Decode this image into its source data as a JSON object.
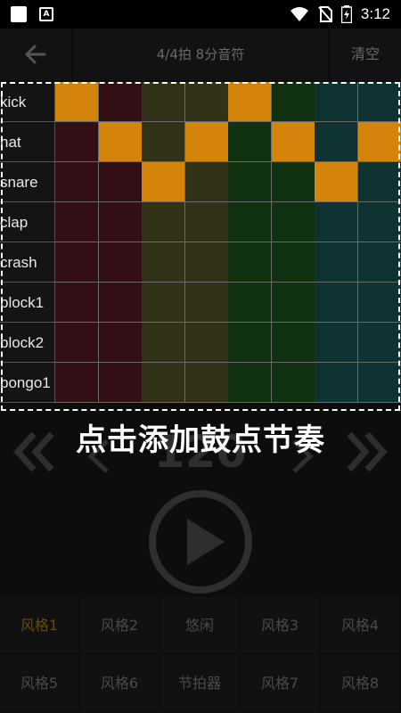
{
  "status_bar": {
    "time": "3:12",
    "notification_icons": [
      "square-icon",
      "a-box-icon"
    ],
    "system_icons": [
      "wifi-icon",
      "no-sim-icon",
      "battery-charging-icon"
    ]
  },
  "topbar": {
    "back_icon": "arrow-left-icon",
    "title": "4/4拍 8分音符",
    "clear_label": "清空"
  },
  "grid": {
    "column_colors": [
      "#320f15",
      "#320f15",
      "#323218",
      "#323218",
      "#113211",
      "#113211",
      "#0f3232",
      "#0f3232"
    ],
    "active_color": "#d4840a",
    "rows": [
      {
        "label": "kick",
        "steps": [
          1,
          0,
          0,
          0,
          1,
          0,
          0,
          0
        ]
      },
      {
        "label": "hat",
        "steps": [
          0,
          1,
          0,
          1,
          0,
          1,
          0,
          1
        ]
      },
      {
        "label": "snare",
        "steps": [
          0,
          0,
          1,
          0,
          0,
          0,
          1,
          0
        ]
      },
      {
        "label": "clap",
        "steps": [
          0,
          0,
          0,
          0,
          0,
          0,
          0,
          0
        ]
      },
      {
        "label": "crash",
        "steps": [
          0,
          0,
          0,
          0,
          0,
          0,
          0,
          0
        ]
      },
      {
        "label": "block1",
        "steps": [
          0,
          0,
          0,
          0,
          0,
          0,
          0,
          0
        ]
      },
      {
        "label": "block2",
        "steps": [
          0,
          0,
          0,
          0,
          0,
          0,
          0,
          0
        ]
      },
      {
        "label": "bongo1",
        "steps": [
          0,
          0,
          0,
          0,
          0,
          0,
          0,
          0
        ]
      }
    ]
  },
  "tutorial_caption": "点击添加鼓点节奏",
  "tempo": {
    "value": "120",
    "fast_back_icon": "double-chevron-left-icon",
    "back_icon": "chevron-left-icon",
    "forward_icon": "chevron-right-icon",
    "fast_forward_icon": "double-chevron-right-icon"
  },
  "play_icon": "play-icon",
  "styles": {
    "row1": [
      "风格1",
      "风格2",
      "悠闲",
      "风格3",
      "风格4"
    ],
    "row2": [
      "风格5",
      "风格6",
      "节拍器",
      "风格7",
      "风格8"
    ],
    "active": "风格1"
  }
}
